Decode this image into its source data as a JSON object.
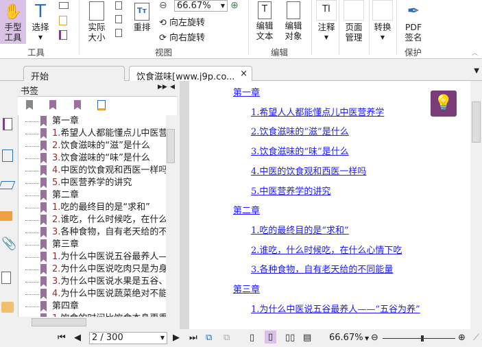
{
  "ribbon": {
    "hand_tool": "手型工具",
    "select": "选择",
    "actual_size": "实际大小",
    "reflow": "重排",
    "zoom_value": "66.67%",
    "rotate_left": "向左旋转",
    "rotate_right": "向右旋转",
    "edit_text": "编辑文本",
    "edit_object": "编辑对象",
    "annotate": "注释",
    "page_manage": "页面管理",
    "convert": "转换",
    "pdf_sign": "PDF签名",
    "groups": {
      "tools": "工具",
      "view": "视图",
      "edit": "编辑",
      "protect": "保护"
    }
  },
  "tabs": [
    {
      "label": "开始"
    },
    {
      "label": "饮食滋味[www.j9p.co..."
    }
  ],
  "bookmarks": {
    "title": "书签",
    "items": [
      {
        "num": "",
        "text": "第一章"
      },
      {
        "num": "1.",
        "text": "希望人人都能懂点儿中医营养学"
      },
      {
        "num": "2.",
        "text": "饮食滋味的“滋”是什么"
      },
      {
        "num": "3.",
        "text": "饮食滋味的“味”是什么"
      },
      {
        "num": "4.",
        "text": "中医的饮食观和西医一样吗"
      },
      {
        "num": "5.",
        "text": "中医营养学的讲究"
      },
      {
        "num": "",
        "text": "第二章"
      },
      {
        "num": "1.",
        "text": "吃的最终目的是“求和”"
      },
      {
        "num": "2.",
        "text": "谁吃，什么时候吃，在什么心情下吃"
      },
      {
        "num": "3.",
        "text": "各种食物，自有老天给的不同能量"
      },
      {
        "num": "",
        "text": "第三章"
      },
      {
        "num": "1.",
        "text": "为什么中医说五谷最养人——“五谷为养”"
      },
      {
        "num": "2.",
        "text": "为什么中医说吃肉只是为身体补益"
      },
      {
        "num": "3.",
        "text": "为什么中医说水果是五谷、五畜的辅助"
      },
      {
        "num": "4.",
        "text": "为什么中医说蔬菜绝对不能当主食"
      },
      {
        "num": "",
        "text": "第四章"
      },
      {
        "num": "1.",
        "text": "饮食的时间比饮食本身更重要得多"
      }
    ]
  },
  "document": {
    "links": [
      {
        "text": "第一章",
        "level": 0
      },
      {
        "text": "1.希望人人都能懂点儿中医营养学",
        "level": 1
      },
      {
        "text": "2.饮食滋味的“滋”是什么",
        "level": 1
      },
      {
        "text": "3.饮食滋味的“味”是什么",
        "level": 1
      },
      {
        "text": "4.中医的饮食观和西医一样吗",
        "level": 1
      },
      {
        "text": "5.中医营养学的讲究",
        "level": 1
      },
      {
        "text": "第二章",
        "level": 0
      },
      {
        "text": "1.吃的最终目的是“求和”",
        "level": 1
      },
      {
        "text": "2.谁吃，什么时候吃，在什么心情下吃",
        "level": 1
      },
      {
        "text": "3.各种食物，自有老天给的不同能量",
        "level": 1
      },
      {
        "text": "第三章",
        "level": 0
      },
      {
        "text": "1.为什么中医说五谷最养人——“五谷为养”",
        "level": 1
      }
    ]
  },
  "status": {
    "page": "2 / 300",
    "zoom": "66.67%",
    "zoom_slider": 0.55
  },
  "colors": {
    "accent": "#9b6fa0",
    "link": "#1a1aff",
    "active": "#d9c2e6"
  }
}
